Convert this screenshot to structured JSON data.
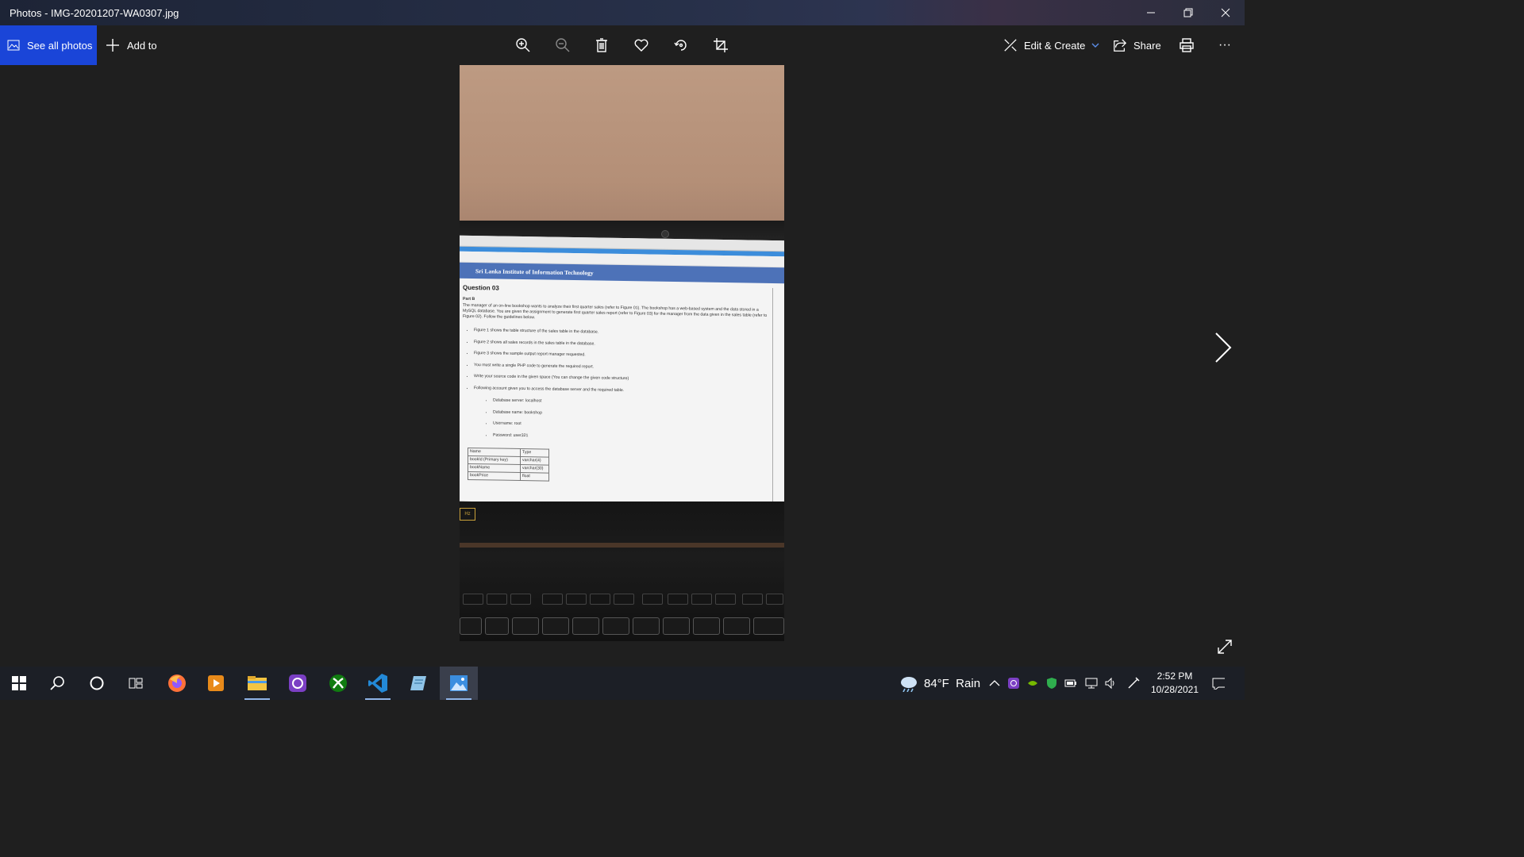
{
  "window": {
    "title": "Photos - IMG-20201207-WA0307.jpg",
    "minimize_icon": "minimize-icon",
    "restore_icon": "restore-icon",
    "close_icon": "close-icon"
  },
  "toolbar": {
    "see_all_photos": "See all photos",
    "add_to": "Add to",
    "edit_create": "Edit & Create",
    "share": "Share",
    "more": "···",
    "icons": [
      "zoom-in-icon",
      "zoom-out-icon",
      "delete-icon",
      "favorite-icon",
      "rotate-icon",
      "crop-icon",
      "print-icon"
    ]
  },
  "photo": {
    "banner": "Sri Lanka Institute of Information Technology",
    "question": "Question 03",
    "part": "Part B",
    "paragraph": "The manager of an on-line bookshop wants to analyze their first quarter sales (refer to Figure 01). The bookshop has a web-based system and the data stored in a MySQL database. You are given the assignment to generate first quarter sales report (refer to Figure 03) for the manager from the data given in the sales table (refer to Figure 02). Follow the guidelines below.",
    "bullets": [
      "Figure 1 shows the table structure of the sales table in the database.",
      "Figure 2 shows all sales records in the sales table in the database.",
      "Figure 3 shows the sample output report manager requested.",
      "You must write a single PHP code to generate the required report.",
      "Write your source code in the given space (You can change the given code structure)",
      "Following account given you to access the database server and the required table."
    ],
    "sub_bullets": [
      "Database server: localhost",
      "Database name: bookshop",
      "Username: root",
      "Password: user321"
    ],
    "table": {
      "headers": [
        "Name",
        "Type"
      ],
      "rows": [
        [
          "bookId      (Primary key)",
          "varchar(4)"
        ],
        [
          "bookName",
          "varchar(30)"
        ],
        [
          "bookPrice",
          "float"
        ]
      ]
    },
    "badge_text": "Hz"
  },
  "taskbar": {
    "weather": "84°F  Rain",
    "time": "2:52 PM",
    "date": "10/28/2021",
    "apps": [
      "start-icon",
      "search-icon",
      "cortana-icon",
      "task-view-icon",
      "firefox-icon",
      "media-player-icon",
      "file-explorer-icon",
      "app-icon",
      "xbox-icon",
      "vscode-icon",
      "notepad-icon",
      "photos-icon"
    ]
  },
  "colors": {
    "accent": "#1a45d8",
    "background": "#1f1f1f",
    "taskbar": "#1c1f26"
  }
}
